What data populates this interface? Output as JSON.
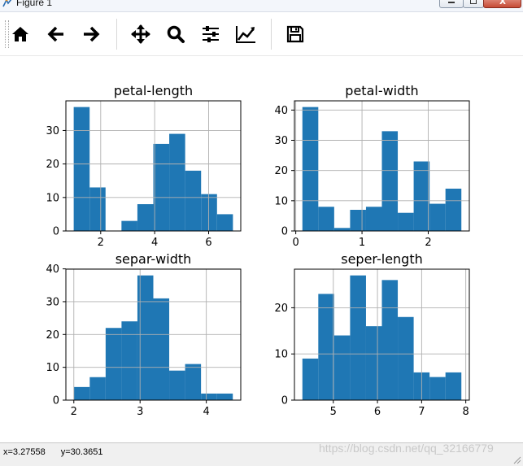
{
  "window": {
    "title": "Figure 1"
  },
  "toolbar": {
    "buttons": [
      {
        "name": "home-button",
        "icon": "home-icon"
      },
      {
        "name": "back-button",
        "icon": "arrow-left-icon"
      },
      {
        "name": "forward-button",
        "icon": "arrow-right-icon"
      },
      {
        "name": "pan-button",
        "icon": "move-icon"
      },
      {
        "name": "zoom-button",
        "icon": "magnifier-icon"
      },
      {
        "name": "configure-subplots-button",
        "icon": "sliders-icon"
      },
      {
        "name": "edit-axes-button",
        "icon": "line-chart-icon"
      },
      {
        "name": "save-button",
        "icon": "floppy-disk-icon"
      }
    ]
  },
  "status": {
    "x_readout": "x=3.27558",
    "y_readout": "y=30.3651"
  },
  "watermark": "https://blog.csdn.net/qq_32166779",
  "colors": {
    "bar": "#1f77b4",
    "grid": "#b0b0b0",
    "axis": "#000000"
  },
  "chart_data": [
    {
      "type": "bar",
      "title": "petal-length",
      "xlim": [
        0.71,
        7.19
      ],
      "ylim": [
        0,
        38.85
      ],
      "xticks": [
        2,
        4,
        6
      ],
      "yticks": [
        0,
        10,
        20,
        30
      ],
      "bin_edges": [
        1.0,
        1.59,
        2.18,
        2.77,
        3.36,
        3.95,
        4.54,
        5.13,
        5.72,
        6.31,
        6.9
      ],
      "values": [
        37,
        13,
        0,
        3,
        8,
        26,
        29,
        18,
        11,
        5
      ],
      "grid": true
    },
    {
      "type": "bar",
      "title": "petal-width",
      "xlim": [
        -0.02,
        2.62
      ],
      "ylim": [
        0,
        43.05
      ],
      "xticks": [
        0,
        1,
        2
      ],
      "yticks": [
        0,
        10,
        20,
        30,
        40
      ],
      "bin_edges": [
        0.1,
        0.34,
        0.58,
        0.82,
        1.06,
        1.3,
        1.54,
        1.78,
        2.02,
        2.26,
        2.5
      ],
      "values": [
        41,
        8,
        1,
        7,
        8,
        33,
        6,
        23,
        9,
        14
      ],
      "grid": true
    },
    {
      "type": "bar",
      "title": "separ-width",
      "xlim": [
        1.88,
        4.52
      ],
      "ylim": [
        0,
        39.9
      ],
      "xticks": [
        2,
        3,
        4
      ],
      "yticks": [
        0,
        10,
        20,
        30,
        40
      ],
      "bin_edges": [
        2.0,
        2.24,
        2.48,
        2.72,
        2.96,
        3.2,
        3.44,
        3.68,
        3.92,
        4.16,
        4.4
      ],
      "values": [
        4,
        7,
        22,
        24,
        38,
        31,
        9,
        11,
        2,
        2
      ],
      "grid": true
    },
    {
      "type": "bar",
      "title": "seper-length",
      "xlim": [
        4.12,
        8.08
      ],
      "ylim": [
        0,
        28.35
      ],
      "xticks": [
        5,
        6,
        7,
        8
      ],
      "yticks": [
        0,
        10,
        20
      ],
      "bin_edges": [
        4.3,
        4.66,
        5.02,
        5.38,
        5.74,
        6.1,
        6.46,
        6.82,
        7.18,
        7.54,
        7.9
      ],
      "values": [
        9,
        23,
        14,
        27,
        16,
        26,
        18,
        6,
        5,
        6
      ],
      "grid": true
    }
  ]
}
